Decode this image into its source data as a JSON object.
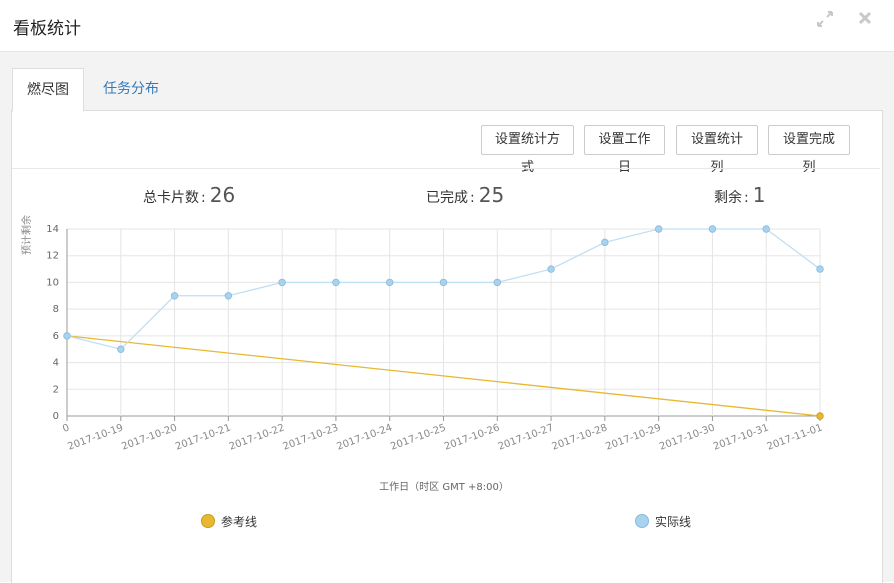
{
  "window": {
    "title": "看板统计",
    "expand_icon": "expand-icon",
    "close_icon": "close-icon"
  },
  "tabs": [
    {
      "label": "燃尽图",
      "active": true
    },
    {
      "label": "任务分布",
      "active": false
    }
  ],
  "toolbar": {
    "stat_method_label": "设置统计方式",
    "workday_label": "设置工作日",
    "stat_column_label": "设置统计列",
    "done_column_label": "设置完成列"
  },
  "stats": {
    "total_label": "总卡片数",
    "total_value": "26",
    "done_label": "已完成",
    "done_value": "25",
    "remaining_label": "剩余",
    "remaining_value": "1",
    "colon": ":"
  },
  "colors": {
    "reference": "#e8b830",
    "actual": "#a8d3ef",
    "actual_line": "#bfdff3",
    "link": "#337ab7"
  },
  "chart_data": {
    "type": "line",
    "title": "",
    "xlabel": "工作日（时区 GMT +8:00）",
    "ylabel": "预计剩余",
    "ylim": [
      0,
      14
    ],
    "yticks": [
      0,
      2,
      4,
      6,
      8,
      10,
      12,
      14
    ],
    "categories": [
      "0",
      "2017-10-19",
      "2017-10-20",
      "2017-10-21",
      "2017-10-22",
      "2017-10-23",
      "2017-10-24",
      "2017-10-25",
      "2017-10-26",
      "2017-10-27",
      "2017-10-28",
      "2017-10-29",
      "2017-10-30",
      "2017-10-31",
      "2017-11-01"
    ],
    "grid": true,
    "legend_position": "bottom",
    "series": [
      {
        "name": "参考线",
        "color": "#e8b830",
        "values": [
          6,
          null,
          null,
          null,
          null,
          null,
          null,
          null,
          null,
          null,
          null,
          null,
          null,
          null,
          0
        ]
      },
      {
        "name": "实际线",
        "color": "#a8d3ef",
        "values": [
          6,
          5,
          9,
          9,
          10,
          10,
          10,
          10,
          10,
          11,
          13,
          14,
          14,
          14,
          11
        ]
      }
    ]
  }
}
